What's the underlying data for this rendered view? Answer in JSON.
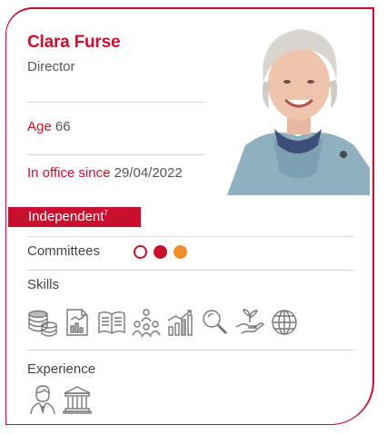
{
  "profile": {
    "name": "Clara Furse",
    "role": "Director",
    "age_label": "Age",
    "age_value": "66",
    "office_label": "In office since",
    "office_value": "29/04/2022",
    "status_badge": "Independent",
    "status_footnote": "7"
  },
  "sections": {
    "committees": "Committees",
    "skills": "Skills",
    "experience": "Experience"
  },
  "committees": [
    {
      "style": "outline",
      "color": "#c8102e"
    },
    {
      "style": "filled",
      "color": "#c8102e"
    },
    {
      "style": "filled",
      "color": "#f28c28"
    }
  ],
  "skills_icons": [
    "coins-stack-icon",
    "financial-report-icon",
    "open-book-icon",
    "team-leader-icon",
    "growth-chart-icon",
    "magnifier-icon",
    "hand-plant-icon",
    "globe-icon"
  ],
  "experience_icons": [
    "person-icon",
    "bank-building-icon"
  ],
  "colors": {
    "accent": "#c8102e",
    "orange": "#f28c28"
  }
}
